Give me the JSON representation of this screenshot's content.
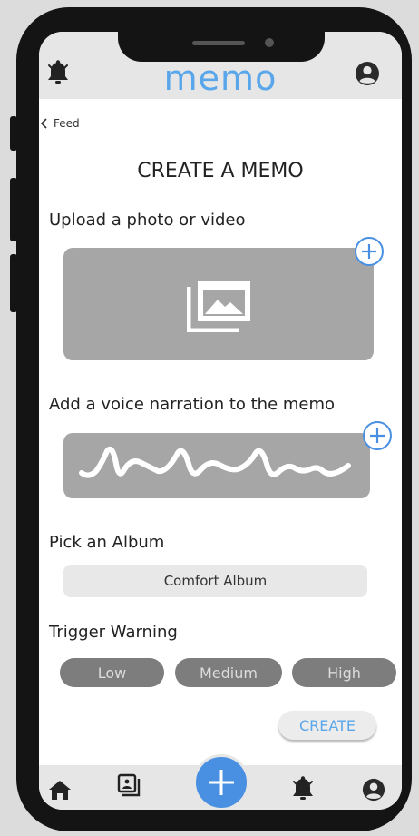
{
  "app": {
    "logo": "memo",
    "accent_color": "#5aa6ea",
    "fab_color": "#4a90e2"
  },
  "header": {
    "left_icon": "bell-icon",
    "right_icon": "user-icon"
  },
  "nav": {
    "back_label": "Feed",
    "back_icon": "chevron-left-icon"
  },
  "page": {
    "title": "CREATE A MEMO"
  },
  "upload": {
    "label": "Upload a photo or video",
    "icon": "photo-gallery-icon",
    "add_icon": "plus-circle-icon"
  },
  "voice": {
    "label": "Add a voice narration to the memo",
    "icon": "waveform-icon",
    "add_icon": "plus-circle-icon"
  },
  "album": {
    "label": "Pick an Album",
    "selected": "Comfort Album"
  },
  "trigger": {
    "label": "Trigger Warning",
    "options": [
      {
        "label": "Low"
      },
      {
        "label": "Medium"
      },
      {
        "label": "High"
      }
    ]
  },
  "actions": {
    "create_label": "CREATE"
  },
  "tabbar": {
    "items": [
      {
        "icon": "home-icon"
      },
      {
        "icon": "photos-icon"
      },
      {
        "icon": "plus-icon"
      },
      {
        "icon": "bell-icon"
      },
      {
        "icon": "user-icon"
      }
    ]
  }
}
